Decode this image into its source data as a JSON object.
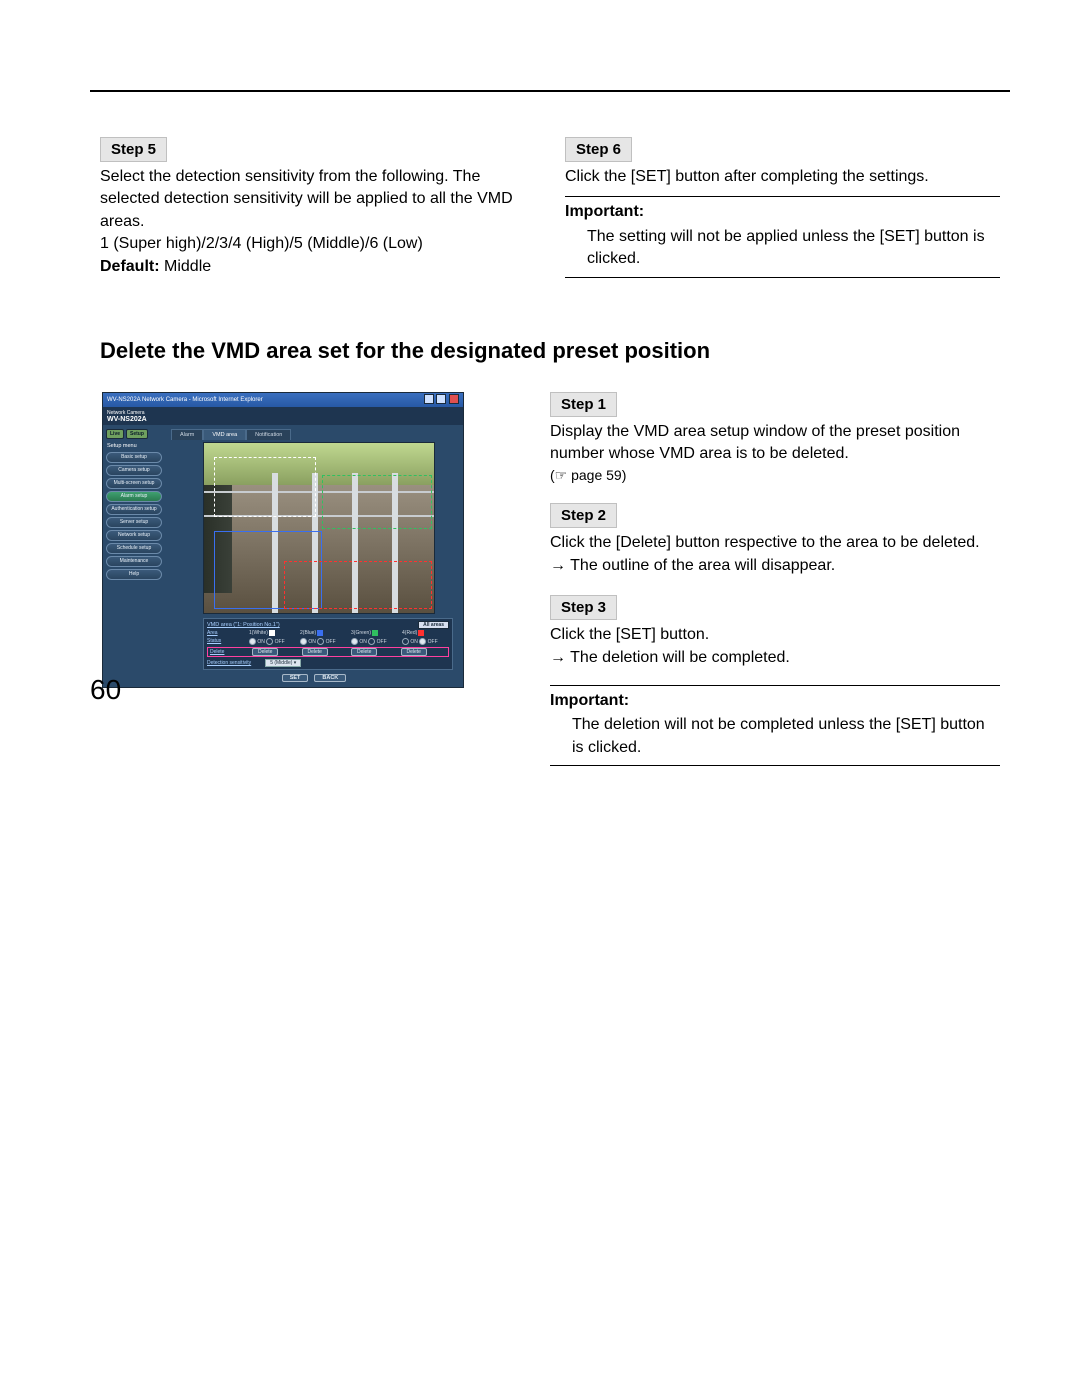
{
  "step5": {
    "label": "Step 5",
    "body1": "Select the detection sensitivity from the following. The selected detection sensitivity will be applied to all the VMD areas.",
    "body2": "1 (Super high)/2/3/4 (High)/5 (Middle)/6 (Low)",
    "default_label": "Default:",
    "default_value": " Middle"
  },
  "step6": {
    "label": "Step 6",
    "body": "Click the [SET] button after completing the settings.",
    "imp_title": "Important:",
    "imp_body": "The setting will not be applied unless the [SET] button is clicked."
  },
  "section_title": "Delete the VMD area set for the designated preset position",
  "right": {
    "s1": {
      "label": "Step 1",
      "body": "Display the VMD area setup window of the preset position number whose VMD area is to be deleted.",
      "ref": "(☞ page 59)"
    },
    "s2": {
      "label": "Step 2",
      "body": "Click the [Delete] button respective to the area to be deleted.",
      "result": "→ The outline of the area will disappear."
    },
    "s3": {
      "label": "Step 3",
      "body": "Click the [SET] button.",
      "result": "→ The deletion will be completed."
    },
    "imp": {
      "title": "Important:",
      "body": "The deletion will not be completed unless the [SET] button is clicked."
    }
  },
  "screenshot": {
    "title_bar": "WV-NS202A Network Camera - Microsoft Internet Explorer",
    "model": "WV-NS202A",
    "model_prefix": "Network Camera",
    "mode_live": "Live",
    "mode_setup": "Setup",
    "setup_menu": "Setup menu",
    "nav": {
      "basic": "Basic setup",
      "camera": "Camera setup",
      "multi": "Multi-screen setup",
      "alarm": "Alarm setup",
      "auth": "Authentication setup",
      "server": "Server setup",
      "network": "Network setup",
      "schedule": "Schedule setup",
      "maint": "Maintenance",
      "help": "Help"
    },
    "tabs": {
      "alarm": "Alarm",
      "vmd": "VMD area",
      "notif": "Notification"
    },
    "panel": {
      "title": "VMD area (\"1: Position No.1\")",
      "all": "All areas",
      "row_area": "Area",
      "row_status": "Status",
      "row_delete": "Delete",
      "a1": "1(White)",
      "a2": "2(Blue)",
      "a3": "3(Green)",
      "a4": "4(Red)",
      "on": "ON",
      "off": "OFF",
      "delete": "Delete",
      "sens": "Detection sensitivity",
      "sens_val": "5 (Middle)",
      "set": "SET",
      "back": "BACK"
    }
  },
  "page_number": "60"
}
